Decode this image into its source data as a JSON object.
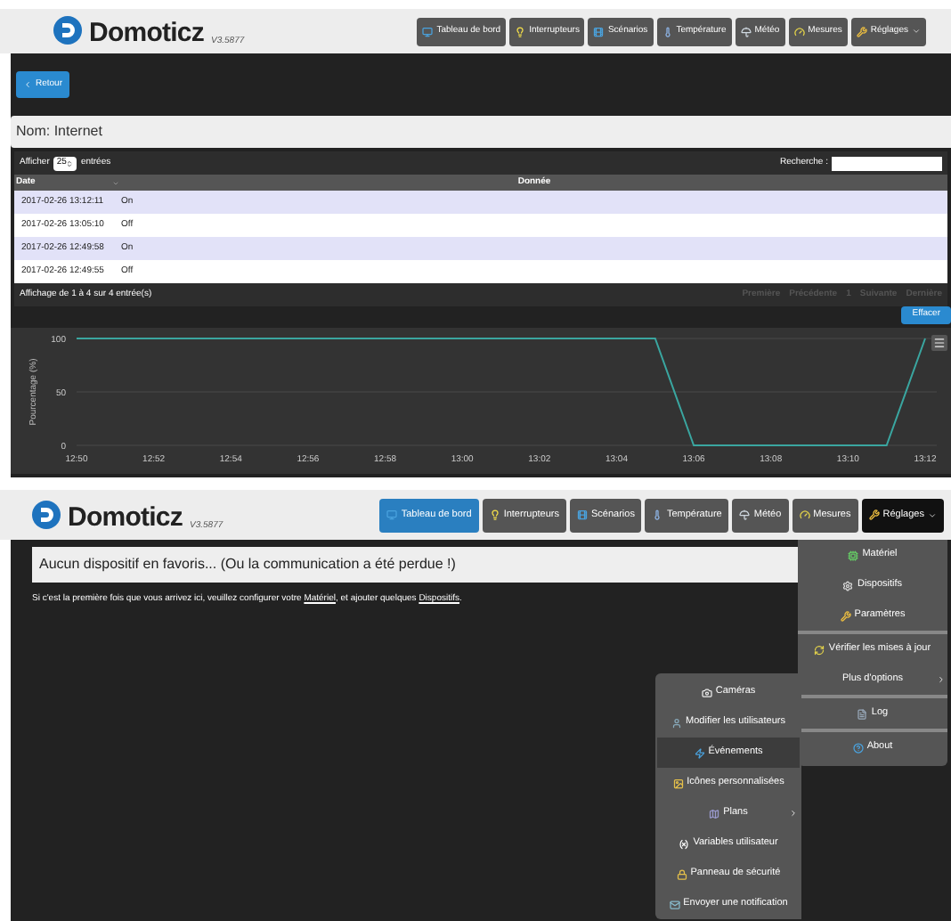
{
  "top_screen": {
    "logo": {
      "name": "Domoticz",
      "version": "V3.5877"
    },
    "nav": [
      {
        "label": "Tableau de bord",
        "selected": false,
        "expanded": false
      },
      {
        "label": "Interrupteurs",
        "selected": false,
        "expanded": false
      },
      {
        "label": "Scénarios",
        "selected": false,
        "expanded": false
      },
      {
        "label": "Température",
        "selected": false,
        "expanded": false
      },
      {
        "label": "Météo",
        "selected": false,
        "expanded": false
      },
      {
        "label": "Mesures",
        "selected": false,
        "expanded": false
      },
      {
        "label": "Réglages",
        "selected": false,
        "expanded": false
      }
    ],
    "back_button": "Retour",
    "device_name": "Nom: Internet",
    "table": {
      "show_label": "Afficher",
      "page_size": "25",
      "entries_label": "entrées",
      "search_label": "Recherche :",
      "columns": [
        "Date",
        "Donnée"
      ],
      "rows": [
        {
          "date": "2017-02-26 13:12:11",
          "value": "On"
        },
        {
          "date": "2017-02-26 13:05:10",
          "value": "Off"
        },
        {
          "date": "2017-02-26 12:49:58",
          "value": "On"
        },
        {
          "date": "2017-02-26 12:49:55",
          "value": "Off"
        }
      ],
      "info": "Affichage de 1 à 4 sur 4 entrée(s)",
      "pagination": [
        {
          "label": "Première",
          "disabled": true
        },
        {
          "label": "Précédente",
          "disabled": true
        },
        {
          "label": "1",
          "disabled": true
        },
        {
          "label": "Suivante",
          "disabled": true
        },
        {
          "label": "Dernière",
          "disabled": true
        }
      ]
    },
    "clear_button": "Effacer",
    "chart": {
      "chart_data": {
        "type": "line",
        "ylabel": "Pourcentage (%)",
        "ylim": [
          0,
          100
        ],
        "categories": [
          "12:50",
          null,
          "12:52",
          null,
          "12:54",
          null,
          "12:56",
          null,
          "12:58",
          null,
          "13:00",
          null,
          "13:02",
          null,
          "13:04",
          null,
          "13:06",
          null,
          "13:08",
          null,
          "13:10",
          null,
          "13:12"
        ],
        "yticks": [
          0,
          50,
          100
        ],
        "series": [
          {
            "color": "#3aa6a0",
            "values": [
              100,
              100,
              100,
              100,
              100,
              100,
              100,
              100,
              100,
              100,
              100,
              100,
              100,
              100,
              100,
              100,
              0,
              0,
              0,
              0,
              0,
              0,
              100
            ]
          }
        ]
      }
    }
  },
  "bottom_screen": {
    "logo": {
      "name": "Domoticz",
      "version": "V3.5877"
    },
    "nav": [
      {
        "label": "Tableau de bord",
        "selected": true,
        "expanded": false
      },
      {
        "label": "Interrupteurs",
        "selected": false,
        "expanded": false
      },
      {
        "label": "Scénarios",
        "selected": false,
        "expanded": false
      },
      {
        "label": "Température",
        "selected": false,
        "expanded": false
      },
      {
        "label": "Météo",
        "selected": false,
        "expanded": false
      },
      {
        "label": "Mesures",
        "selected": false,
        "expanded": false
      },
      {
        "label": "Réglages",
        "selected": false,
        "expanded": true
      }
    ],
    "message": "Aucun dispositif en favoris... (Ou la communication a été perdue !)",
    "hint": {
      "before": "Si c'est la première fois que vous arrivez ici, veuillez configurer votre",
      "link_1": "Matériel",
      "middle": ", et ajouter quelques",
      "link_2": "Dispositifs",
      "after": "."
    },
    "settings_menu": [
      [
        {
          "label": "Matériel",
          "has_submenu": false
        },
        {
          "label": "Dispositifs",
          "has_submenu": false
        },
        {
          "label": "Paramètres",
          "has_submenu": false
        }
      ],
      [
        {
          "label": "Vérifier les mises à jour",
          "has_submenu": false
        },
        {
          "label": "Plus d'options",
          "has_submenu": true
        }
      ],
      [
        {
          "label": "Log",
          "has_submenu": false
        }
      ],
      [
        {
          "label": "About",
          "has_submenu": false
        }
      ]
    ],
    "more_options_menu": [
      {
        "label": "Caméras",
        "highlighted": false,
        "has_submenu": false
      },
      {
        "label": "Modifier les utilisateurs",
        "highlighted": false,
        "has_submenu": false
      },
      {
        "label": "Événements",
        "highlighted": true,
        "has_submenu": false
      },
      {
        "label": "Icônes personnalisées",
        "highlighted": false,
        "has_submenu": false
      },
      {
        "label": "Plans",
        "highlighted": false,
        "has_submenu": true
      },
      {
        "label": "Variables utilisateur",
        "highlighted": false,
        "has_submenu": false
      },
      {
        "label": "Panneau de sécurité",
        "highlighted": false,
        "has_submenu": false
      },
      {
        "label": "Envoyer une notification",
        "highlighted": false,
        "has_submenu": false
      }
    ]
  }
}
